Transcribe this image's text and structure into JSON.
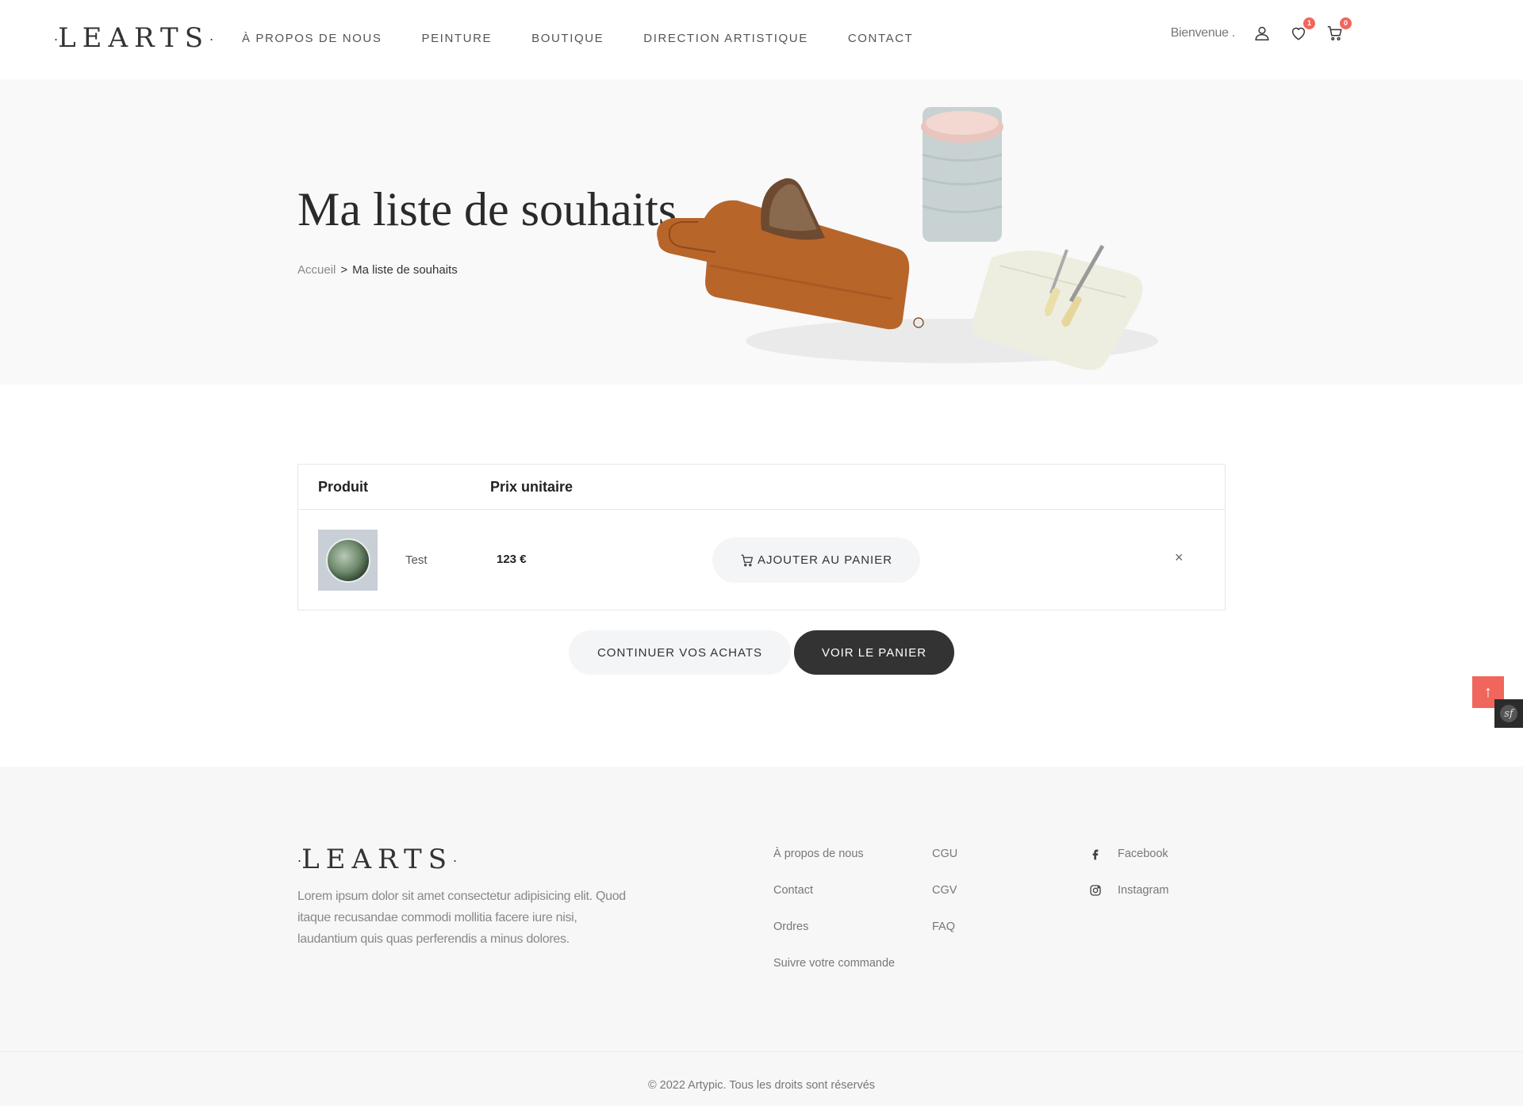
{
  "brand": {
    "name": "LEARTS",
    "dot": "·"
  },
  "nav": [
    {
      "label": "À PROPOS DE NOUS"
    },
    {
      "label": "PEINTURE"
    },
    {
      "label": "BOUTIQUE"
    },
    {
      "label": "DIRECTION ARTISTIQUE"
    },
    {
      "label": "CONTACT"
    }
  ],
  "header": {
    "greeting": "Bienvenue .",
    "wishlist_count": "1",
    "cart_count": "0"
  },
  "hero": {
    "title": "Ma liste de souhaits",
    "breadcrumb_home": "Accueil",
    "breadcrumb_sep": ">",
    "breadcrumb_current": "Ma liste de souhaits"
  },
  "wishlist": {
    "col_product": "Produit",
    "col_price": "Prix unitaire",
    "items": [
      {
        "name": "Test",
        "price": "123 €",
        "add_label": "AJOUTER AU PANIER",
        "remove": "×"
      }
    ]
  },
  "actions": {
    "continue_label": "CONTINUER VOS ACHATS",
    "cart_label": "VOIR LE PANIER"
  },
  "colors": {
    "accent": "#f0665c",
    "dark": "#333333",
    "hero_bg": "#f9f9fa",
    "footer_bg": "#f7f7f7"
  },
  "footer": {
    "description": "Lorem ipsum dolor sit amet consectetur adipisicing elit. Quod itaque recusandae commodi mollitia facere iure nisi, laudantium quis quas perferendis a minus dolores.",
    "col1": [
      "À propos de nous",
      "Contact",
      "Ordres",
      "Suivre votre commande"
    ],
    "col2": [
      "CGU",
      "CGV",
      "FAQ"
    ],
    "social": [
      {
        "label": "Facebook",
        "icon": "facebook-icon"
      },
      {
        "label": "Instagram",
        "icon": "instagram-icon"
      }
    ],
    "copyright": "© 2022 Artypic. Tous les droits sont réservés"
  },
  "widgets": {
    "to_top": "↑",
    "symfony": "sf"
  }
}
